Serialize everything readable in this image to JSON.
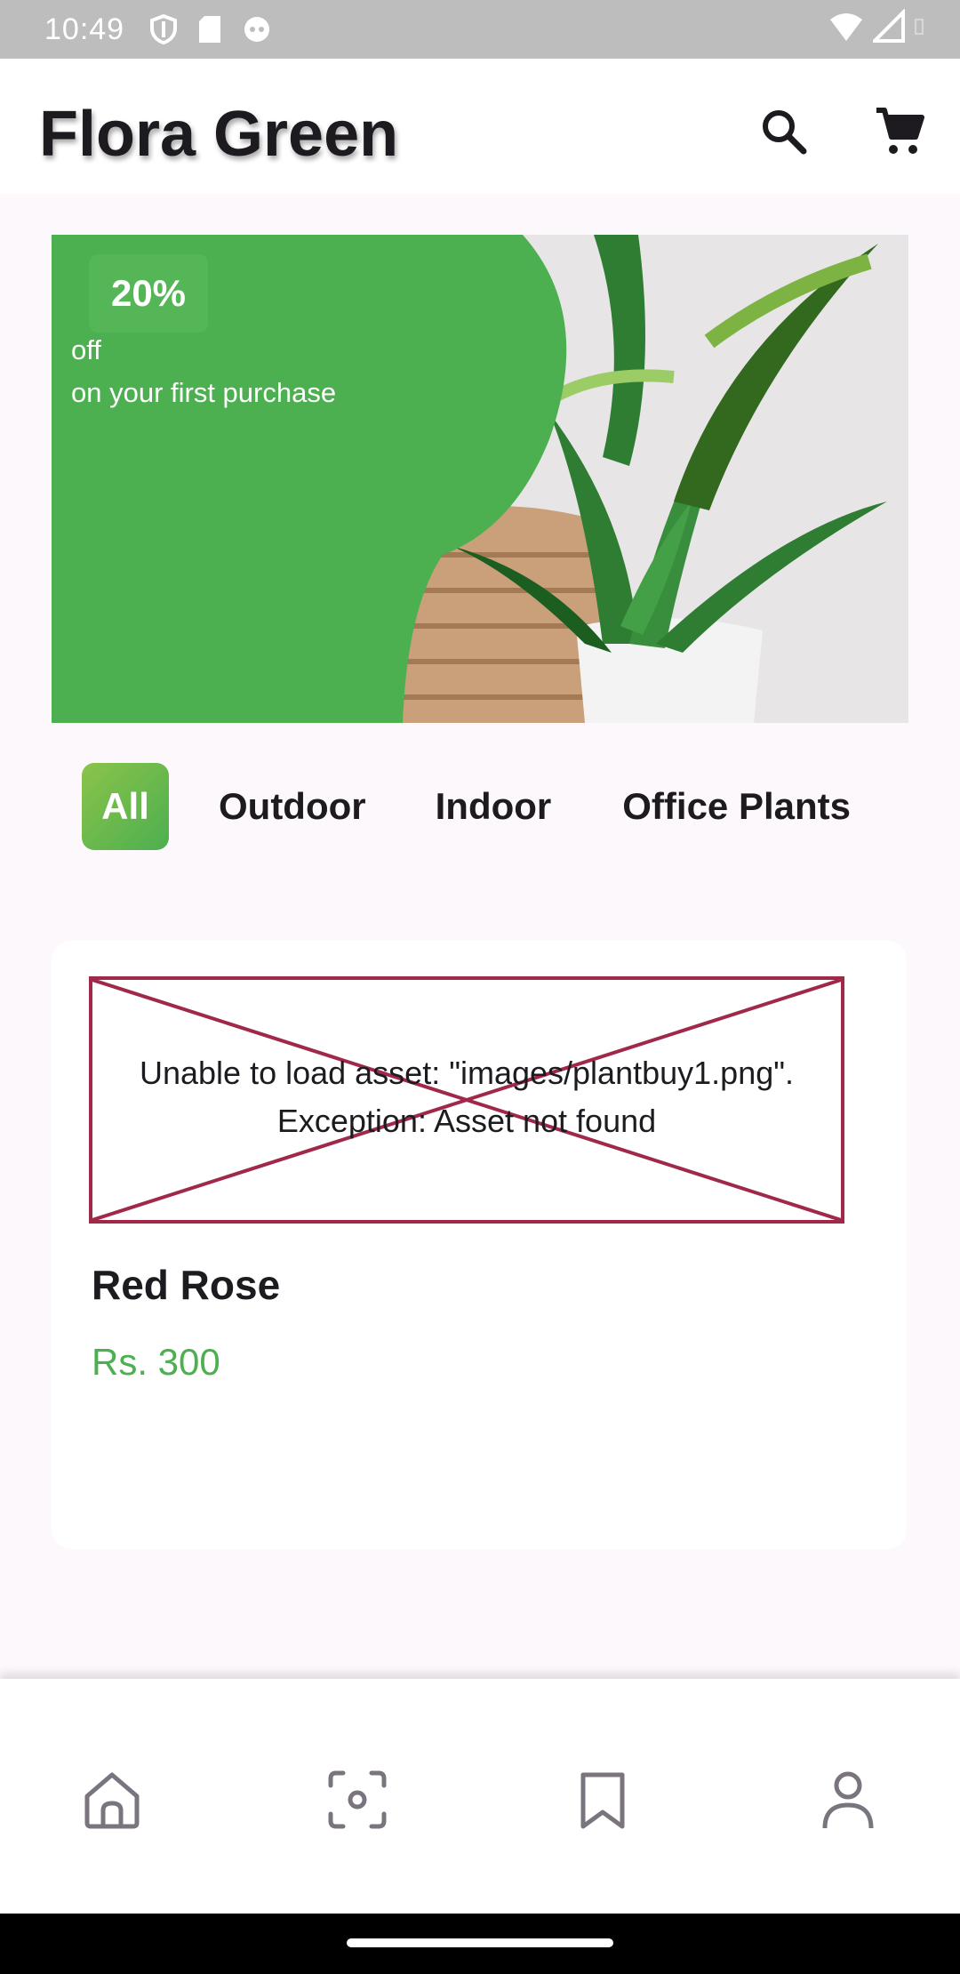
{
  "status_bar": {
    "time": "10:49"
  },
  "app_bar": {
    "title": "Flora Green",
    "search_icon": "search-icon",
    "cart_icon": "cart-icon"
  },
  "banner": {
    "discount": "20%",
    "line1": "off",
    "line2": "on your first purchase"
  },
  "categories": {
    "items": [
      "All",
      "Outdoor",
      "Indoor",
      "Office Plants"
    ],
    "selected": "All"
  },
  "product": {
    "image_error_line1": "Unable to load asset: \"images/plantbuy1.png\".",
    "image_error_line2": "Exception: Asset not found",
    "name": "Red Rose",
    "price": "Rs. 300"
  },
  "bottom_nav": {
    "items": [
      "home-icon",
      "scan-icon",
      "bookmark-icon",
      "profile-icon"
    ]
  },
  "colors": {
    "accent_green": "#4caf50",
    "error_border": "#a0294a",
    "background": "#fdf8fc"
  }
}
